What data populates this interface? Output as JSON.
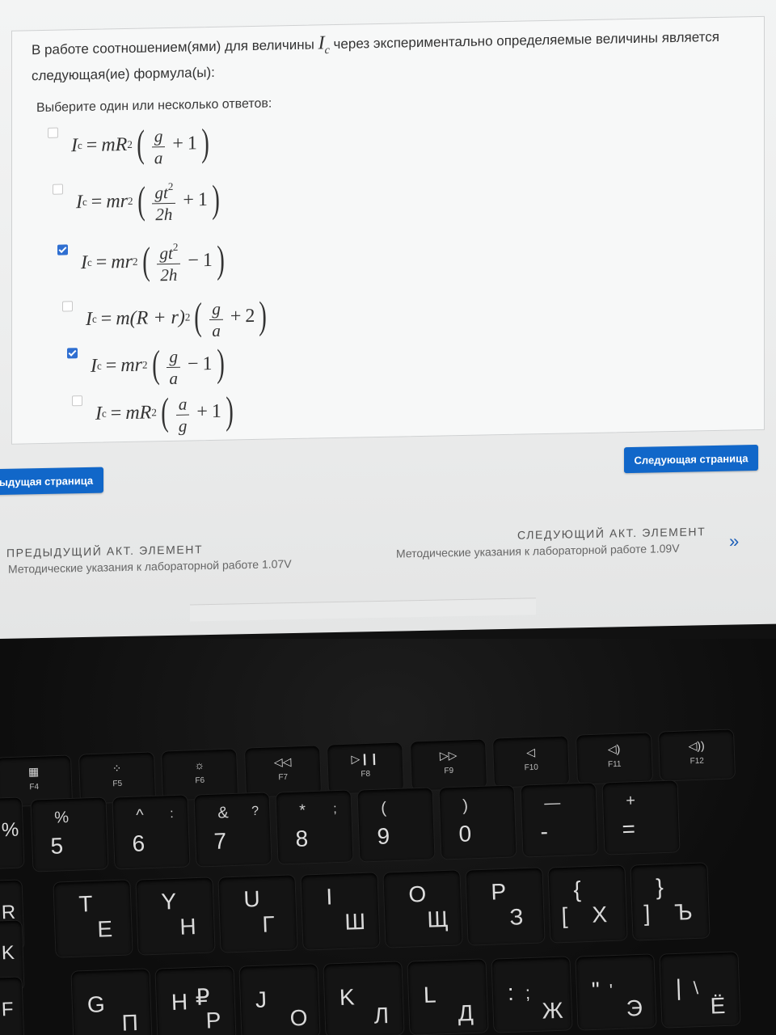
{
  "question": {
    "text_before": "В работе соотношением(ями) для величины",
    "symbol": "I",
    "symbol_sub": "c",
    "text_after": "через экспериментально определяемые величины является следующая(ие) формула(ы):"
  },
  "prompt": "Выберите один или несколько ответов:",
  "options": [
    {
      "checked": false,
      "lhs": "I",
      "lhs_sub": "c",
      "coef": "mR",
      "coef_pow": "2",
      "num": "g",
      "num_pow": "",
      "den": "a",
      "op": "+",
      "const": "1"
    },
    {
      "checked": false,
      "lhs": "I",
      "lhs_sub": "c",
      "coef": "mr",
      "coef_pow": "2",
      "num": "gt",
      "num_pow": "2",
      "den": "2h",
      "op": "+",
      "const": "1"
    },
    {
      "checked": true,
      "lhs": "I",
      "lhs_sub": "c",
      "coef": "mr",
      "coef_pow": "2",
      "num": "gt",
      "num_pow": "2",
      "den": "2h",
      "op": "−",
      "const": "1"
    },
    {
      "checked": false,
      "lhs": "I",
      "lhs_sub": "c",
      "coef": "m(R + r)",
      "coef_pow": "2",
      "num": "g",
      "num_pow": "",
      "den": "a",
      "op": "+",
      "const": "2"
    },
    {
      "checked": true,
      "lhs": "I",
      "lhs_sub": "c",
      "coef": "mr",
      "coef_pow": "2",
      "num": "g",
      "num_pow": "",
      "den": "a",
      "op": "−",
      "const": "1"
    },
    {
      "checked": false,
      "lhs": "I",
      "lhs_sub": "c",
      "coef": "mR",
      "coef_pow": "2",
      "num": "a",
      "num_pow": "",
      "den": "g",
      "op": "+",
      "const": "1"
    }
  ],
  "buttons": {
    "prev_page": "ыдущая страница",
    "next_page": "Следующая страница"
  },
  "nav": {
    "prev_caption": "ПРЕДЫДУЩИЙ АКТ. ЭЛЕМЕНТ",
    "prev_link": "Методические указания к лабораторной работе 1.07V",
    "next_caption": "СЛЕДУЮЩИЙ АКТ. ЭЛЕМЕНТ",
    "next_link": "Методические указания к лабораторной работе 1.09V",
    "next_arrow": "»"
  },
  "keyboard": {
    "fkeys": [
      {
        "label": "F4",
        "icon": "grid-icon",
        "glyph": "▦"
      },
      {
        "label": "F5",
        "icon": "brightness-down-icon",
        "glyph": "⁘"
      },
      {
        "label": "F6",
        "icon": "brightness-up-icon",
        "glyph": "☼"
      },
      {
        "label": "F7",
        "icon": "rewind-icon",
        "glyph": "◁◁"
      },
      {
        "label": "F8",
        "icon": "play-pause-icon",
        "glyph": "▷❙❙"
      },
      {
        "label": "F9",
        "icon": "fast-forward-icon",
        "glyph": "▷▷"
      },
      {
        "label": "F10",
        "icon": "mute-icon",
        "glyph": "◁"
      },
      {
        "label": "F11",
        "icon": "volume-down-icon",
        "glyph": "◁)"
      },
      {
        "label": "F12",
        "icon": "volume-up-icon",
        "glyph": "◁))"
      }
    ],
    "number_row": [
      {
        "top": "%",
        "main": "5"
      },
      {
        "top": "^",
        "main": "6",
        "alt": ":"
      },
      {
        "top": "&",
        "main": "7",
        "alt": "?"
      },
      {
        "top": "*",
        "main": "8",
        "alt": ";"
      },
      {
        "top": "(",
        "main": "9"
      },
      {
        "top": ")",
        "main": "0"
      },
      {
        "top": "—",
        "main": "-"
      },
      {
        "top": "+",
        "main": "="
      }
    ],
    "letter_row_1": [
      {
        "en": "T",
        "ru": "Е"
      },
      {
        "en": "Y",
        "ru": "Н"
      },
      {
        "en": "U",
        "ru": "Г"
      },
      {
        "en": "I",
        "ru": "Ш"
      },
      {
        "en": "O",
        "ru": "Щ"
      },
      {
        "en": "P",
        "ru": "З"
      },
      {
        "en": "{",
        "ru": "Х",
        "mid": "["
      },
      {
        "en": "}",
        "ru": "Ъ",
        "mid": "]"
      }
    ],
    "letter_row_2": [
      {
        "en": "G",
        "ru": "П"
      },
      {
        "en": "H",
        "ru": "Р",
        "alt": "₽"
      },
      {
        "en": "J",
        "ru": "О"
      },
      {
        "en": "K",
        "ru": "Л"
      },
      {
        "en": "L",
        "ru": "Д"
      },
      {
        "en": ":",
        "ru": "Ж",
        "mid": ";"
      },
      {
        "en": "\"",
        "ru": "Э",
        "mid": "'"
      },
      {
        "en": "|",
        "ru": "Ё",
        "mid": "\\"
      }
    ],
    "edge_left": [
      "%",
      "R",
      "K",
      "F"
    ]
  }
}
